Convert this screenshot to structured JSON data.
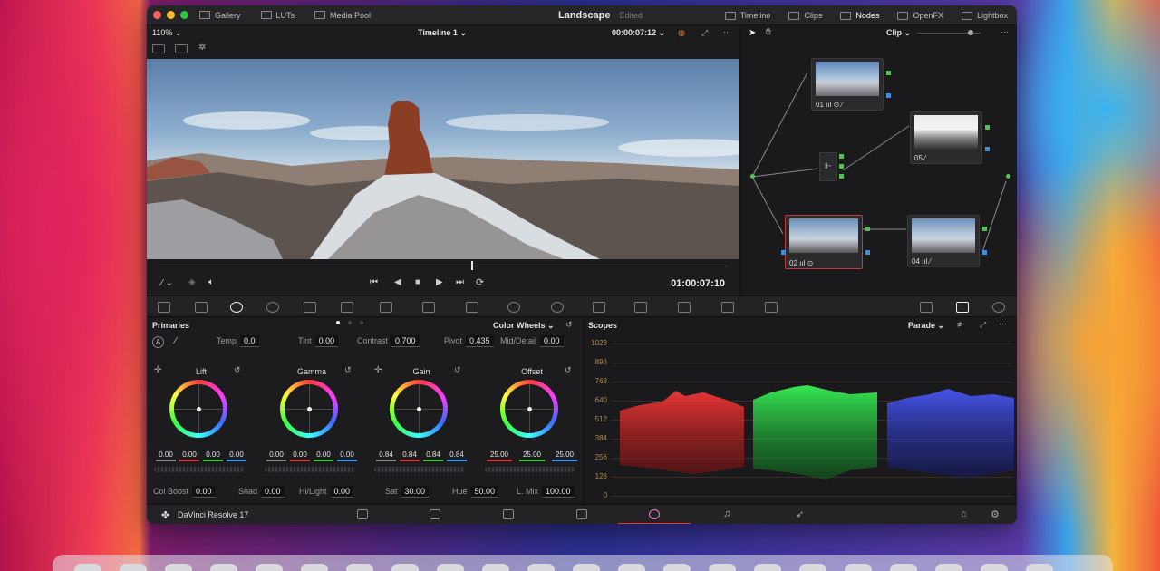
{
  "topbar": {
    "left_buttons": [
      "Gallery",
      "LUTs",
      "Media Pool"
    ],
    "project_name": "Landscape",
    "project_status": "Edited",
    "right_buttons": [
      "Timeline",
      "Clips",
      "Nodes",
      "OpenFX",
      "Lightbox"
    ],
    "active_right": "Nodes"
  },
  "viewer": {
    "zoom": "110%",
    "timeline_name": "Timeline 1",
    "timecode_top": "00:00:07:12",
    "timecode_big": "01:00:07:10",
    "playhead_fraction": 0.55
  },
  "nodes": {
    "mode": "Clip",
    "items": [
      {
        "label": "01"
      },
      {
        "label": "05"
      },
      {
        "label": "02"
      },
      {
        "label": "04"
      }
    ]
  },
  "primaries": {
    "title": "Primaries",
    "mode": "Color Wheels",
    "adjust": {
      "temp_label": "Temp",
      "temp": "0.0",
      "tint_label": "Tint",
      "tint": "0.00",
      "contrast_label": "Contrast",
      "contrast": "0.700",
      "pivot_label": "Pivot",
      "pivot": "0.435",
      "middetail_label": "Mid/Detail",
      "middetail": "0.00"
    },
    "wheels": [
      {
        "name": "Lift",
        "values": [
          "0.00",
          "0.00",
          "0.00",
          "0.00"
        ]
      },
      {
        "name": "Gamma",
        "values": [
          "0.00",
          "0.00",
          "0.00",
          "0.00"
        ]
      },
      {
        "name": "Gain",
        "values": [
          "0.84",
          "0.84",
          "0.84",
          "0.84"
        ]
      },
      {
        "name": "Offset",
        "values": [
          "25.00",
          "25.00",
          "25.00"
        ]
      }
    ],
    "bottom": {
      "colboost_label": "Col Boost",
      "colboost": "0.00",
      "shad_label": "Shad",
      "shad": "0.00",
      "hilight_label": "Hi/Light",
      "hilight": "0.00",
      "sat_label": "Sat",
      "sat": "30.00",
      "hue_label": "Hue",
      "hue": "50.00",
      "lmix_label": "L. Mix",
      "lmix": "100.00"
    }
  },
  "scopes": {
    "title": "Scopes",
    "mode": "Parade",
    "ticks": [
      "1023",
      "896",
      "768",
      "640",
      "512",
      "384",
      "256",
      "128",
      "0"
    ]
  },
  "pagebar": {
    "app_name": "DaVinci Resolve 17",
    "active_page": "color"
  },
  "colors": {
    "accent_red": "#e23a3a",
    "node_green": "#4fc24f",
    "node_blue": "#3a8fe0"
  }
}
